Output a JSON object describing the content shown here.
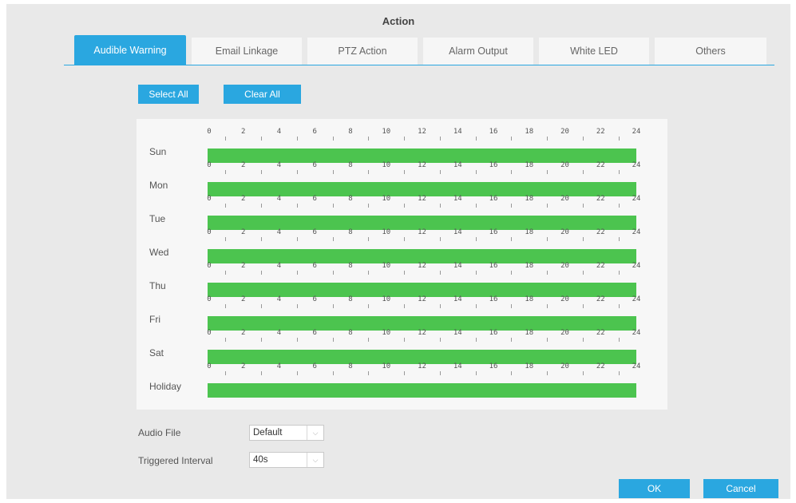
{
  "dialog": {
    "title": "Action"
  },
  "tabs": [
    {
      "label": "Audible Warning",
      "active": true
    },
    {
      "label": "Email Linkage",
      "active": false
    },
    {
      "label": "PTZ Action",
      "active": false
    },
    {
      "label": "Alarm Output",
      "active": false
    },
    {
      "label": "White LED",
      "active": false
    },
    {
      "label": "Others",
      "active": false
    }
  ],
  "schedule": {
    "select_all_label": "Select All",
    "clear_all_label": "Clear All",
    "hour_ticks": [
      "0",
      "2",
      "4",
      "6",
      "8",
      "10",
      "12",
      "14",
      "16",
      "18",
      "20",
      "22",
      "24"
    ],
    "days": [
      {
        "label": "Sun",
        "selected_fraction": 1
      },
      {
        "label": "Mon",
        "selected_fraction": 1
      },
      {
        "label": "Tue",
        "selected_fraction": 1
      },
      {
        "label": "Wed",
        "selected_fraction": 1
      },
      {
        "label": "Thu",
        "selected_fraction": 1
      },
      {
        "label": "Fri",
        "selected_fraction": 1
      },
      {
        "label": "Sat",
        "selected_fraction": 1
      },
      {
        "label": "Holiday",
        "selected_fraction": 1
      }
    ],
    "bar_color": "#4cc44f"
  },
  "form": {
    "audio_file_label": "Audio File",
    "audio_file_value": "Default",
    "interval_label": "Triggered Interval",
    "interval_value": "40s"
  },
  "footer": {
    "ok_label": "OK",
    "cancel_label": "Cancel"
  },
  "colors": {
    "accent": "#2aa7e0",
    "background": "#e9e9e9"
  }
}
